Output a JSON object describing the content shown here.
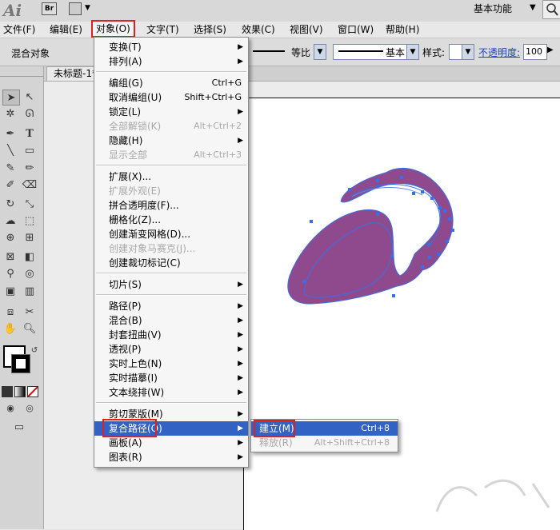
{
  "titlebar": {
    "app_logo": "Ai",
    "bridge_button": "Br",
    "workspace": "基本功能"
  },
  "menubar": {
    "items": [
      "文件(F)",
      "编辑(E)",
      "对象(O)",
      "文字(T)",
      "选择(S)",
      "效果(C)",
      "视图(V)",
      "窗口(W)",
      "帮助(H)"
    ]
  },
  "controlbar": {
    "selection_label": "混合对象",
    "stroke_profile": "等比",
    "brush": "基本",
    "style_label": "样式:",
    "opacity_label": "不透明度:",
    "opacity_value": "100"
  },
  "document": {
    "tab_title": "未标题-1*"
  },
  "object_menu": {
    "items": [
      {
        "label": "变换(T)",
        "submenu": true
      },
      {
        "label": "排列(A)",
        "submenu": true
      },
      {
        "label": "编组(G)",
        "shortcut": "Ctrl+G"
      },
      {
        "label": "取消编组(U)",
        "shortcut": "Shift+Ctrl+G"
      },
      {
        "label": "锁定(L)",
        "submenu": true
      },
      {
        "label": "全部解锁(K)",
        "shortcut": "Alt+Ctrl+2",
        "disabled": true
      },
      {
        "label": "隐藏(H)",
        "submenu": true
      },
      {
        "label": "显示全部",
        "shortcut": "Alt+Ctrl+3",
        "disabled": true
      },
      {
        "label": "扩展(X)..."
      },
      {
        "label": "扩展外观(E)",
        "disabled": true
      },
      {
        "label": "拼合透明度(F)..."
      },
      {
        "label": "栅格化(Z)..."
      },
      {
        "label": "创建渐变网格(D)..."
      },
      {
        "label": "创建对象马赛克(J)...",
        "disabled": true
      },
      {
        "label": "创建裁切标记(C)"
      },
      {
        "label": "切片(S)",
        "submenu": true
      },
      {
        "label": "路径(P)",
        "submenu": true
      },
      {
        "label": "混合(B)",
        "submenu": true
      },
      {
        "label": "封套扭曲(V)",
        "submenu": true
      },
      {
        "label": "透视(P)",
        "submenu": true
      },
      {
        "label": "实时上色(N)",
        "submenu": true
      },
      {
        "label": "实时描摹(I)",
        "submenu": true
      },
      {
        "label": "文本绕排(W)",
        "submenu": true
      },
      {
        "label": "剪切蒙版(M)",
        "submenu": true
      },
      {
        "label": "复合路径(O)",
        "submenu": true,
        "highlighted": true
      },
      {
        "label": "画板(A)",
        "submenu": true
      },
      {
        "label": "图表(R)",
        "submenu": true
      }
    ]
  },
  "compound_path_submenu": {
    "items": [
      {
        "label": "建立(M)",
        "shortcut": "Ctrl+8",
        "highlighted": true
      },
      {
        "label": "释放(R)",
        "shortcut": "Alt+Shift+Ctrl+8",
        "disabled": true
      }
    ]
  },
  "colors": {
    "shape_fill": "#8e4a8c",
    "selection_blue": "#3a6ee8",
    "menu_highlight": "#3162c4",
    "annotation_red": "#e02020"
  }
}
